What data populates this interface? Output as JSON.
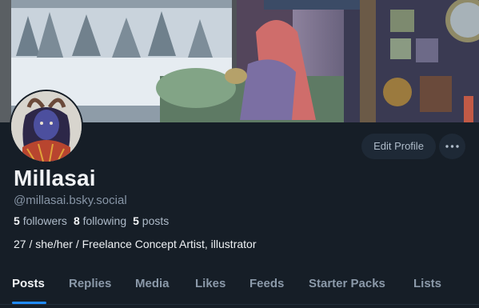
{
  "profile": {
    "display_name": "Millasai",
    "handle": "@millasai.bsky.social",
    "followers_count": "5",
    "followers_label": "followers",
    "following_count": "8",
    "following_label": "following",
    "posts_count": "5",
    "posts_label": "posts",
    "bio": "27 / she/her / Freelance Concept Artist, illustrator"
  },
  "actions": {
    "edit_profile_label": "Edit Profile",
    "more_icon": "more-horizontal-icon"
  },
  "tabs": [
    {
      "label": "Posts",
      "active": true
    },
    {
      "label": "Replies",
      "active": false
    },
    {
      "label": "Media",
      "active": false
    },
    {
      "label": "Likes",
      "active": false
    },
    {
      "label": "Feeds",
      "active": false
    },
    {
      "label": "Starter Packs",
      "active": false
    },
    {
      "label": "Lists",
      "active": false
    }
  ],
  "colors": {
    "background": "#161e27",
    "accent": "#208bfe",
    "muted_text": "#8b99a9",
    "button_bg": "#1e2936"
  }
}
